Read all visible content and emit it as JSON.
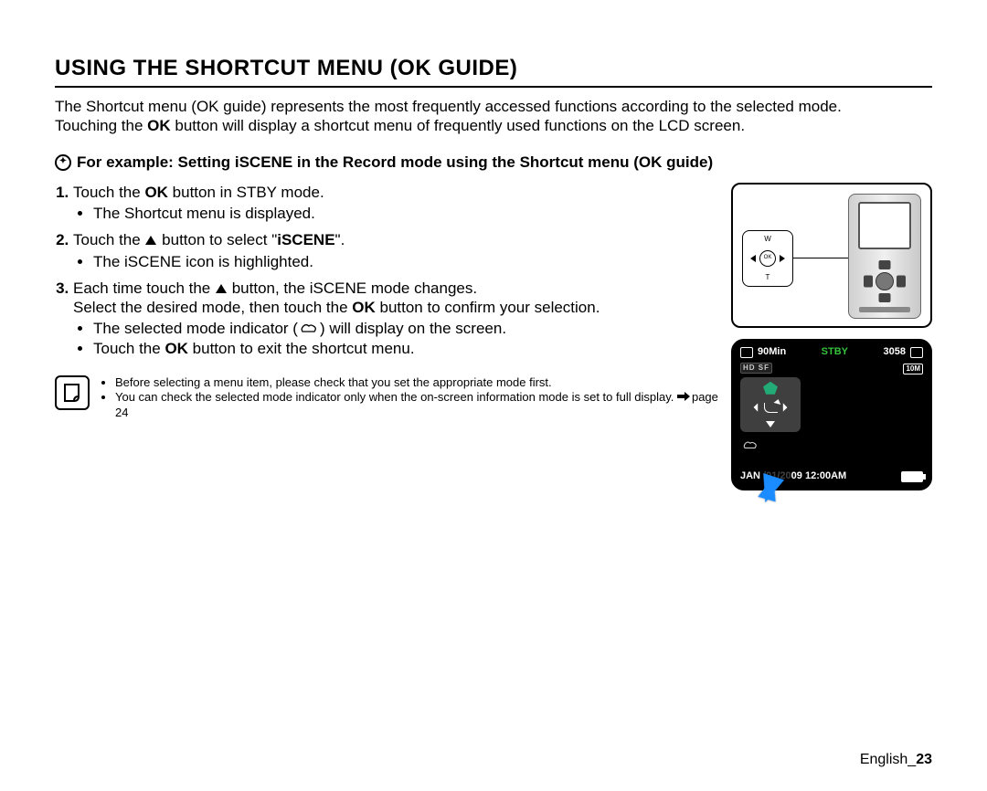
{
  "title": "USING THE SHORTCUT MENU (OK GUIDE)",
  "intro": {
    "line1": "The Shortcut menu (OK guide) represents the most frequently accessed functions according to the selected mode.",
    "line2_a": "Touching the ",
    "line2_ok": "OK",
    "line2_b": " button will display a shortcut menu of frequently used functions on the LCD screen."
  },
  "example": "For example: Setting iSCENE in the Record mode using the Shortcut menu (OK guide)",
  "steps": {
    "s1": {
      "a": "Touch the ",
      "ok": "OK",
      "b": " button in STBY mode.",
      "sub": "The Shortcut menu is displayed."
    },
    "s2": {
      "a": "Touch the ",
      "b": " button to select \"",
      "iscene": "iSCENE",
      "c": "\".",
      "sub": "The iSCENE icon is highlighted."
    },
    "s3": {
      "a": "Each time touch the ",
      "b": " button, the iSCENE mode changes.",
      "line2a": "Select the desired mode, then touch the ",
      "ok": "OK",
      "line2b": " button to confirm your selection.",
      "sub1a": "The selected mode indicator (",
      "sub1b": ") will display on the screen.",
      "sub2a": "Touch the ",
      "sub2ok": "OK",
      "sub2b": " button to exit the shortcut menu."
    }
  },
  "notes": {
    "n1": "Before selecting a menu item, please check that you set the appropriate mode first.",
    "n2a": "You can check the selected mode indicator only when the on-screen information mode is set to full display. ",
    "n2b": "page 24"
  },
  "dpad": {
    "w": "W",
    "ok": "OK",
    "t": "T"
  },
  "lcd": {
    "time": "90Min",
    "stby": "STBY",
    "count": "3058",
    "tenM": "10M",
    "hd": "HD SF",
    "left_sym": "🞀",
    "right_sym": "🞂",
    "datetime_a": "JAN",
    "datetime_b": "09 12:00AM"
  },
  "footer": {
    "lang": "English_",
    "page": "23"
  }
}
